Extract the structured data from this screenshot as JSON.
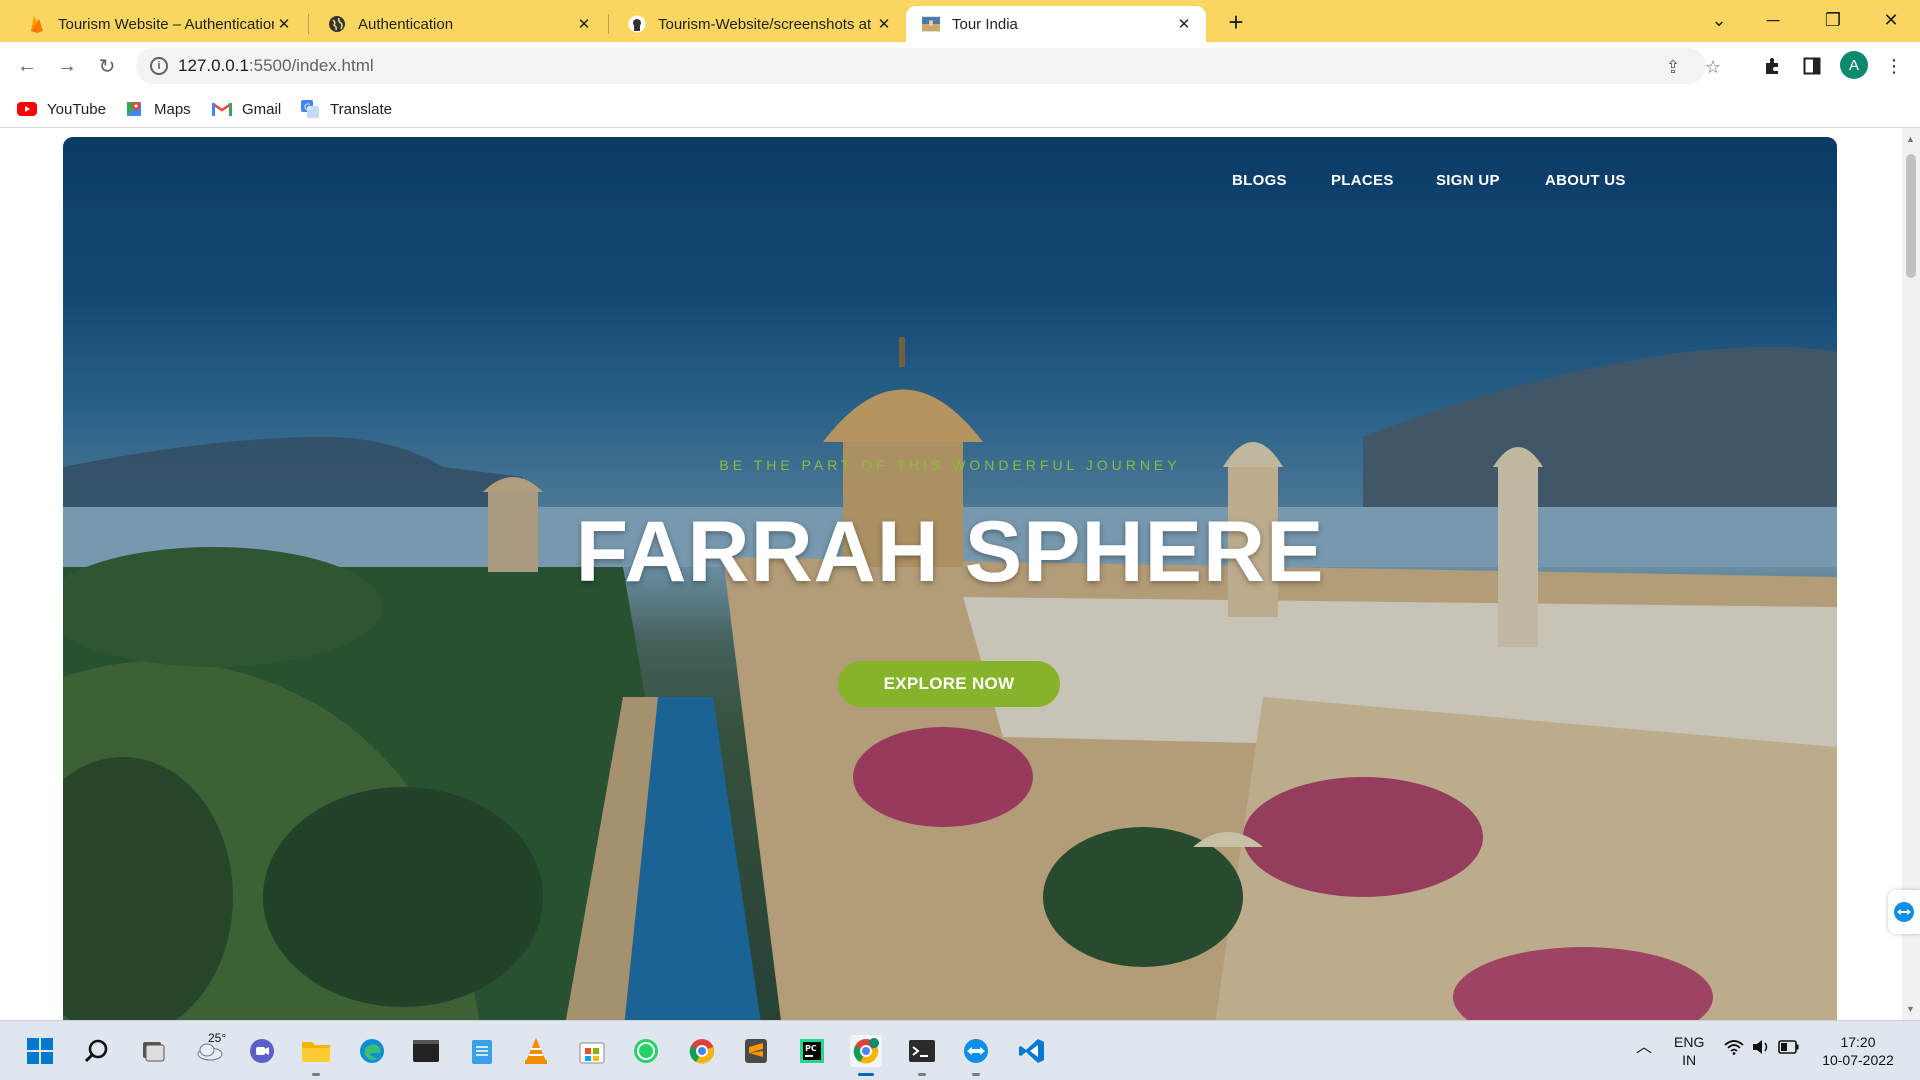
{
  "browser": {
    "tabs": [
      {
        "title": "Tourism Website – Authentication",
        "icon": "firebase-icon",
        "active": false
      },
      {
        "title": "Authentication",
        "icon": "globe-icon",
        "active": false
      },
      {
        "title": "Tourism-Website/screenshots at",
        "icon": "github-icon",
        "active": false
      },
      {
        "title": "Tour India",
        "icon": "tour-thumbnail-icon",
        "active": true
      }
    ],
    "new_tab_label": "+",
    "url_host": "127.0.0.1",
    "url_rest": ":5500/index.html",
    "avatar_letter": "A",
    "bookmarks": [
      {
        "label": "YouTube",
        "icon": "youtube-icon"
      },
      {
        "label": "Maps",
        "icon": "maps-icon"
      },
      {
        "label": "Gmail",
        "icon": "gmail-icon"
      },
      {
        "label": "Translate",
        "icon": "translate-icon"
      }
    ]
  },
  "page": {
    "nav": [
      "BLOGS",
      "PLACES",
      "SIGN UP",
      "ABOUT US"
    ],
    "tagline": "BE THE PART OF THIS WONDERFUL JOURNEY",
    "title": "FARRAH SPHERE",
    "cta": "EXPLORE NOW",
    "colors": {
      "accent": "#86b32a",
      "tagline": "#8dbb3a"
    }
  },
  "taskbar": {
    "weather_temp": "25°",
    "language_line1": "ENG",
    "language_line2": "IN",
    "time": "17:20",
    "date": "10-07-2022",
    "apps": [
      "windows-start-icon",
      "search-icon",
      "task-view-icon",
      "weather-icon",
      "teams-chat-icon",
      "file-explorer-icon",
      "edge-icon",
      "terminal-icon",
      "notepad-icon",
      "vlc-icon",
      "microsoft-store-icon",
      "whatsapp-icon",
      "chrome-icon",
      "sublime-text-icon",
      "pycharm-icon",
      "chrome-profile-icon",
      "command-prompt-icon",
      "teamviewer-icon",
      "vscode-icon"
    ]
  }
}
